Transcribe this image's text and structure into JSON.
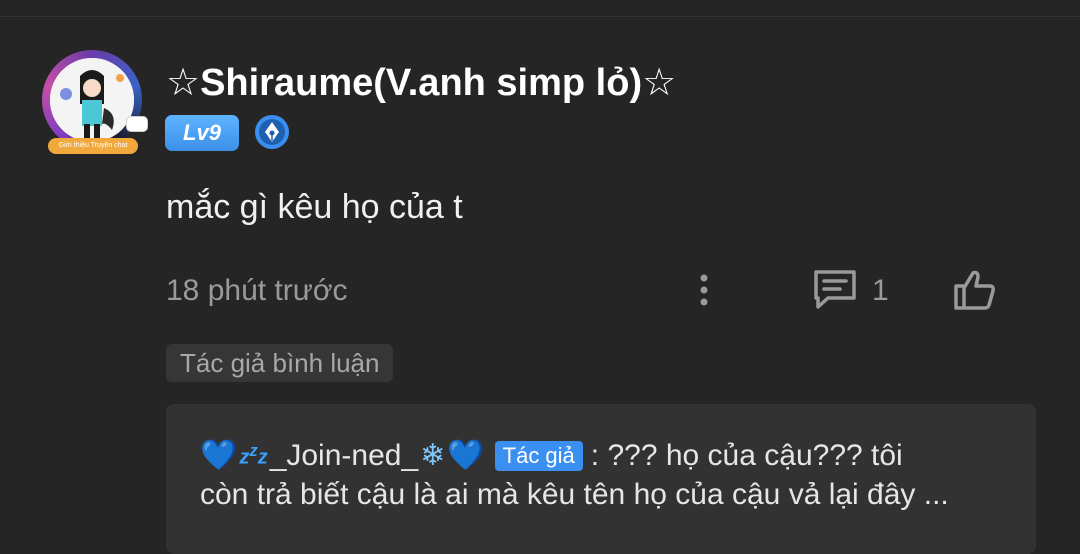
{
  "comment": {
    "username": "☆Shiraume(V.anh simp lỏ)☆",
    "level": "Lv9",
    "avatar_badge_text": "Giới thiệu Truyện chat",
    "text": "mắc gì kêu họ của t",
    "timestamp": "18 phút trước",
    "reply_count": "1",
    "author_tag": "Tác giả bình luận"
  },
  "reply": {
    "username": "_Join-ned_",
    "role_badge": "Tác giả",
    "text_line1": ": ??? họ của cậu??? tôi",
    "text_line2": "còn trả biết cậu là ai mà kêu tên họ của cậu vả lại đây ..."
  },
  "icons": {
    "more": "more-vertical-icon",
    "reply": "comment-icon",
    "like": "thumbs-up-icon",
    "pen": "pen-nib-icon"
  },
  "colors": {
    "background": "#252525",
    "accent_blue": "#3b8ff0",
    "muted_text": "#9a9a9a"
  }
}
